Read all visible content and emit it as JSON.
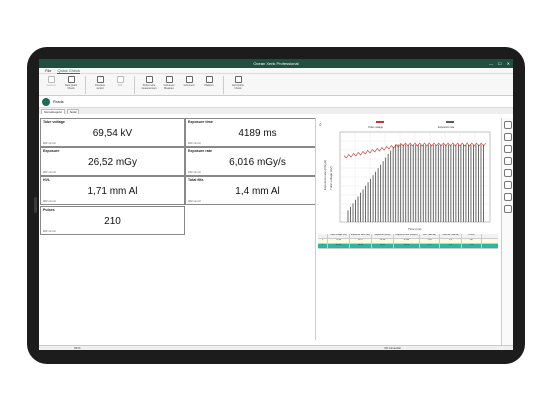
{
  "window": {
    "title": "Ocean Xenk Professional"
  },
  "menu": {
    "items": [
      "File",
      "Quick Check"
    ]
  },
  "ribbon": {
    "buttons": [
      {
        "label": "Connect",
        "dim": true
      },
      {
        "label": "New Quick Check",
        "dim": false
      },
      {
        "label": "Previous record",
        "dim": false
      },
      {
        "label": "Edit",
        "dim": true
      },
      {
        "label": "Show more measurement",
        "dim": false
      },
      {
        "label": "Comment Measure",
        "dim": false
      },
      {
        "label": "Comment",
        "dim": false
      },
      {
        "label": "Platform",
        "dim": false
      },
      {
        "label": "Exit Quick Check",
        "dim": false
      }
    ]
  },
  "device": {
    "name": "Rrads"
  },
  "tabs": [
    "Normal/Legend",
    "Serial"
  ],
  "measurements": [
    {
      "label": "Tube voltage",
      "value": "69,54 kV",
      "unit": "W/2 mm Al"
    },
    {
      "label": "Exposure time",
      "value": "4189 ms",
      "unit": "W/2 mm Al"
    },
    {
      "label": "Exposure",
      "value": "26,52 mGy",
      "unit": "W/2 mm Al"
    },
    {
      "label": "Exposure rate",
      "value": "6,016 mGy/s",
      "unit": "W/2 mm Al"
    },
    {
      "label": "HVL",
      "value": "1,71 mm Al",
      "unit": "W/2 mm Al"
    },
    {
      "label": "Total filtr.",
      "value": "1,4 mm Al",
      "unit": "W/2 mm Al"
    },
    {
      "label": "Pulses",
      "value": "210",
      "unit": "W/2 mm Al"
    }
  ],
  "chart_data": {
    "type": "line",
    "series": [
      {
        "name": "Tube voltage",
        "color": "#c0392b"
      },
      {
        "name": "Exposure rate",
        "color": "#5a5a5a"
      }
    ],
    "ylabel": "Exposure rate (mGy/s)",
    "ylabel2": "Tube voltage (kV)",
    "xlabel": "Time (ms)"
  },
  "result_table": {
    "headers": [
      "",
      "Tube voltage (kV)",
      "Exposure time (ms)",
      "Exposure (mGy)",
      "Exposure rate (mGy/s)",
      "HVL (mm Al)",
      "Total filtr. (mm Al)",
      "Pulses"
    ],
    "rows": [
      [
        "1",
        "71,85",
        "4127",
        "26,38",
        "6,248",
        "1,69",
        "1,4",
        "207"
      ],
      [
        "2",
        "69,54",
        "4189",
        "26,52",
        "6,016",
        "1,71",
        "1,4",
        "210"
      ]
    ]
  },
  "status": {
    "left": "OK %",
    "right": "NO connection"
  },
  "colors": {
    "accent": "#1f4f3f"
  }
}
